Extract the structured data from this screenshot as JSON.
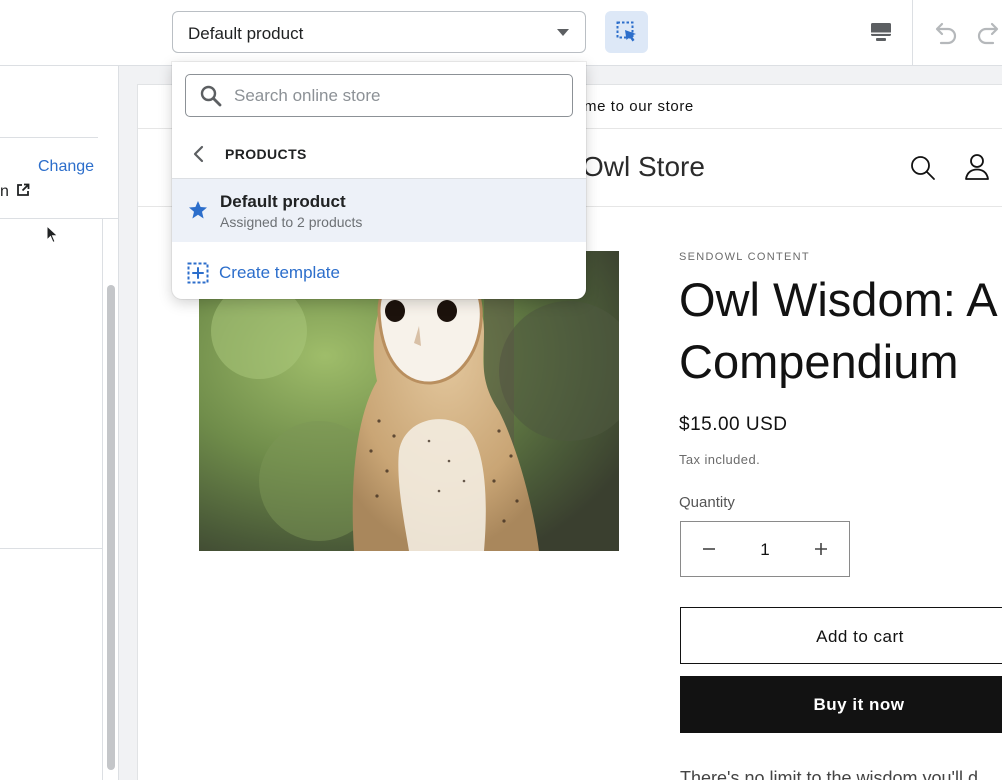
{
  "topbar": {
    "template_select": {
      "label": "Default product",
      "icon": "caret-down-icon"
    },
    "inspector_icon": "select-inspector-icon",
    "device_icon": "desktop-icon",
    "undo_icon": "undo-icon",
    "redo_icon": "redo-icon"
  },
  "left_panel": {
    "change_link": "Change",
    "partial_text": "n",
    "external_icon": "external-link-icon"
  },
  "dropdown": {
    "search": {
      "placeholder": "Search online store"
    },
    "back_label": "PRODUCTS",
    "items": [
      {
        "name": "Default product",
        "subtitle": "Assigned to 2 products",
        "icon": "star-icon",
        "selected": true
      }
    ],
    "create_label": "Create template"
  },
  "preview": {
    "announcement": "me to our store",
    "store_name": "Owl Store",
    "vendor": "SENDOWL CONTENT",
    "product_title": "Owl Wisdom: A Compendium",
    "price": "$15.00 USD",
    "tax_note": "Tax included.",
    "quantity_label": "Quantity",
    "quantity_value": "1",
    "add_to_cart": "Add to cart",
    "buy_now": "Buy it now",
    "description_partial": "There's no limit to the wisdom you'll d"
  },
  "colors": {
    "accent": "#2c6ecb",
    "selected_bg": "#edf1f8",
    "buy_now_bg": "#121212"
  }
}
